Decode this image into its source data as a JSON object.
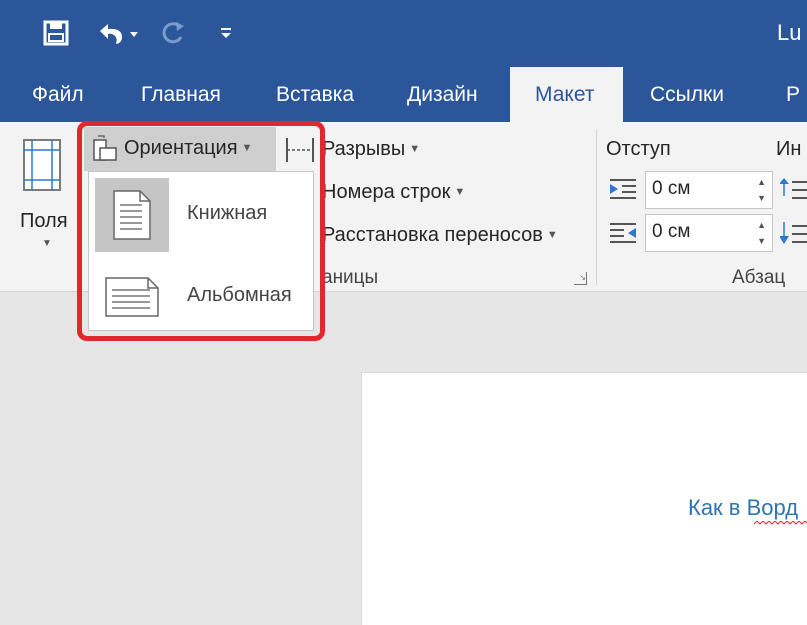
{
  "titlebar": {
    "title": "Lu",
    "save_icon": "save-icon",
    "undo_icon": "undo-icon",
    "redo_icon": "redo-icon",
    "customize_icon": "customize-qat-icon"
  },
  "tabs": [
    {
      "label": "Файл"
    },
    {
      "label": "Главная"
    },
    {
      "label": "Вставка"
    },
    {
      "label": "Дизайн"
    },
    {
      "label": "Макет",
      "active": true
    },
    {
      "label": "Ссылки"
    },
    {
      "label": "Р"
    }
  ],
  "ribbon": {
    "margins_label": "Поля",
    "orientation_label": "Ориентация",
    "breaks_label": "Разрывы",
    "line_numbers_label": "Номера строк",
    "hyphenation_label": "Расстановка переносов",
    "page_setup_group_label": "аницы",
    "indent_label": "Отступ",
    "spacing_label": "Ин",
    "indent_left_value": "0 см",
    "indent_right_value": "0 см",
    "paragraph_group_label": "Абзац"
  },
  "orientation_menu": {
    "items": [
      {
        "label": "Книжная",
        "icon": "portrait-page-icon",
        "selected": true
      },
      {
        "label": "Альбомная",
        "icon": "landscape-page-icon",
        "selected": false
      }
    ]
  },
  "document": {
    "text": "Как в Ворд"
  },
  "colors": {
    "brand": "#2b579a",
    "highlight": "#e0282e",
    "doc_text": "#2e74b5"
  }
}
